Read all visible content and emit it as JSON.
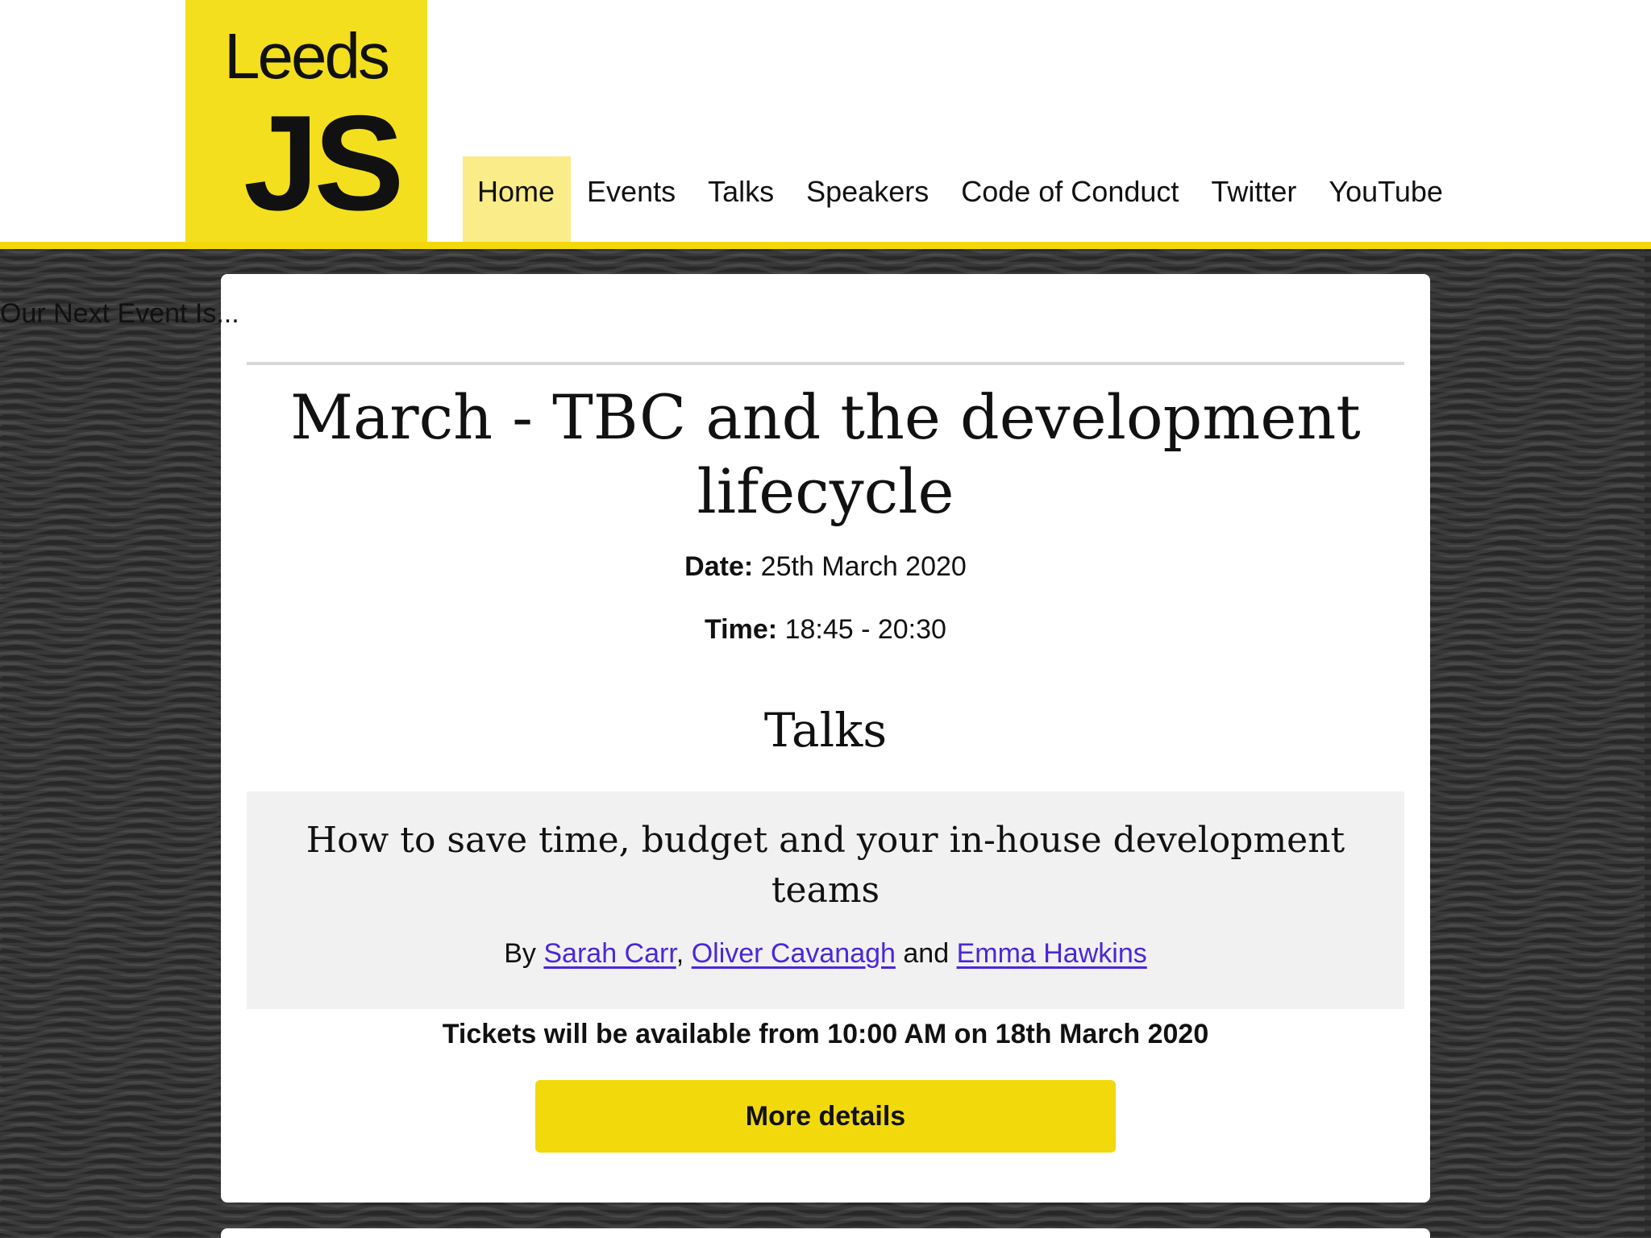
{
  "logo": {
    "line1": "Leeds",
    "line2": "JS"
  },
  "nav": {
    "items": [
      "Home",
      "Events",
      "Talks",
      "Speakers",
      "Code of Conduct",
      "Twitter",
      "YouTube"
    ],
    "active": "Home"
  },
  "event": {
    "heading": "Our Next Event Is...",
    "title": "March - TBC and the development lifecycle",
    "date_label": "Date:",
    "date_value": "25th March 2020",
    "time_label": "Time:",
    "time_value": "18:45 - 20:30"
  },
  "talks": {
    "heading": "Talks",
    "items": [
      {
        "title": "How to save time, budget and your in-house development teams",
        "by_prefix": "By",
        "speakers": [
          "Sarah Carr",
          "Oliver Cavanagh",
          "Emma Hawkins"
        ],
        "sep1": ",",
        "sep2": "and"
      }
    ]
  },
  "tickets_text": "Tickets will be available from 10:00 AM on 18th March 2020",
  "cta_label": "More details",
  "colors": {
    "brand_yellow": "#f4df1e",
    "button_yellow": "#f1d90c",
    "active_nav": "#fbec8a",
    "link": "#4a27d8",
    "background": "#2c2c2c"
  }
}
